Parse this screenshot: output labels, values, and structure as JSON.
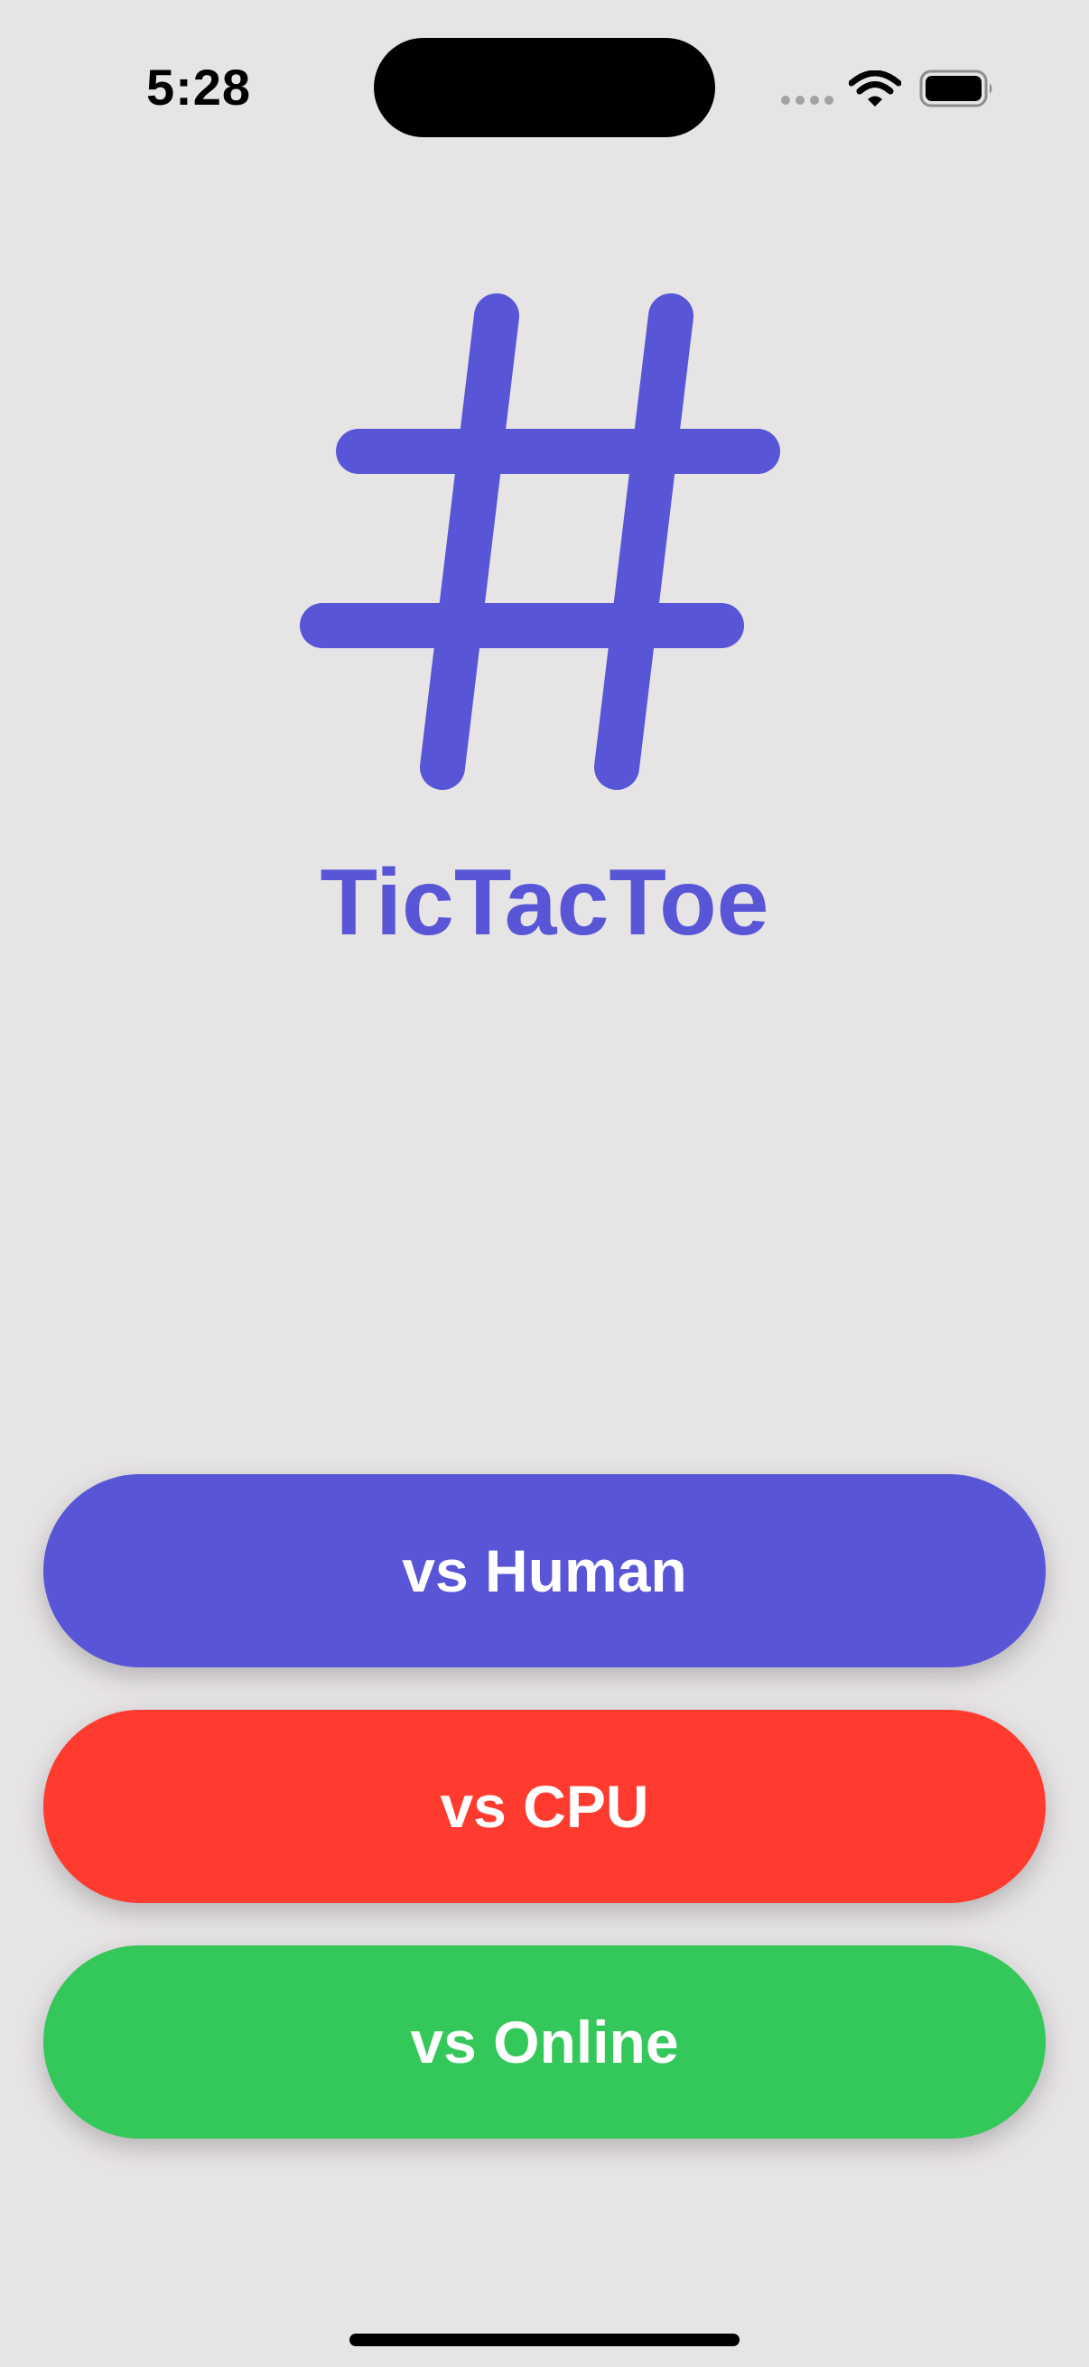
{
  "status_bar": {
    "time": "5:28"
  },
  "app": {
    "title": "TicTacToe",
    "logo_icon": "number-sign-icon"
  },
  "buttons": [
    {
      "label": "vs Human",
      "color": "#5856d6"
    },
    {
      "label": "vs CPU",
      "color": "#ff3b30"
    },
    {
      "label": "vs Online",
      "color": "#34c759"
    }
  ],
  "colors": {
    "background": "#e7e4e6",
    "accent": "#5856d6"
  }
}
